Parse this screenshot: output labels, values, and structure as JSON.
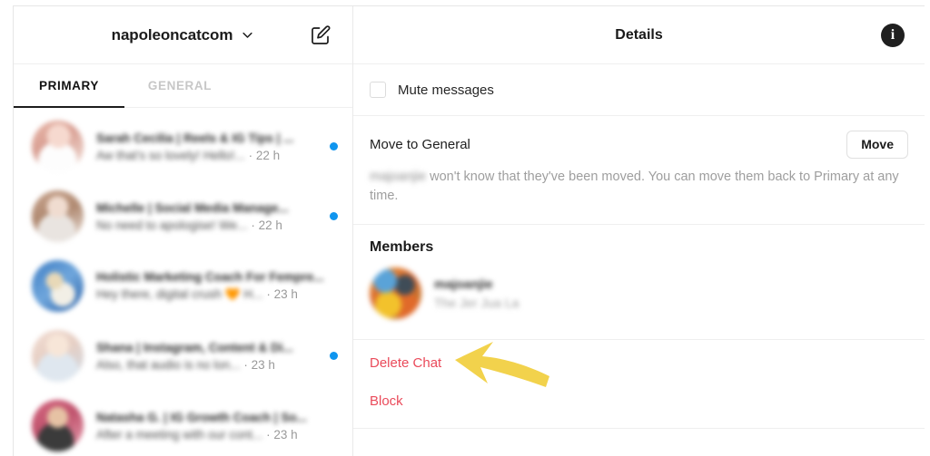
{
  "window": {
    "left_panel": {
      "header": {
        "account_name": "napoleoncatcom",
        "chevron_icon": "chevron-down-icon",
        "compose_icon": "compose-edit-icon"
      },
      "tabs": [
        {
          "label": "PRIMARY",
          "active": true
        },
        {
          "label": "GENERAL",
          "active": false
        }
      ],
      "conversations": [
        {
          "name": "Sarah Cecilia | Reels & IG Tips | ...",
          "preview": "Aw that's so lovely! Hello!...",
          "time": "· 22 h",
          "unread": true
        },
        {
          "name": "Michelle | Social Media Manage...",
          "preview": "No need to apologise! We...",
          "time": "· 22 h",
          "unread": true
        },
        {
          "name": "Holistic Marketing Coach For Fempre...",
          "preview": "Hey there, digital crush 🧡 H...",
          "time": "· 23 h",
          "unread": false
        },
        {
          "name": "Shana | Instagram, Content & Di...",
          "preview": "Also, that audio is no lon...",
          "time": "· 23 h",
          "unread": true
        },
        {
          "name": "Natasha G. | IG Growth Coach | So...",
          "preview": "After a meeting with our cont...",
          "time": "· 23 h",
          "unread": false
        }
      ]
    },
    "right_panel": {
      "header": {
        "title": "Details",
        "info_icon": "info-circle-icon",
        "info_glyph": "i"
      },
      "mute": {
        "label": "Mute messages",
        "checked": false,
        "checkbox_icon": "checkbox-unchecked-icon"
      },
      "move": {
        "title": "Move to General",
        "button_label": "Move",
        "redacted_username": "majoanjie",
        "description": " won't know that they've been moved. You can move them back to Primary at any time."
      },
      "members": {
        "title": "Members",
        "list": [
          {
            "name": "majoanjie",
            "subtitle": "The Jer Jua La",
            "avatar_icon": "member-avatar"
          }
        ]
      },
      "actions": [
        {
          "label": "Delete Chat",
          "name": "delete-chat-link"
        },
        {
          "label": "Block",
          "name": "block-link"
        }
      ],
      "annotation": {
        "arrow_icon": "arrow-left-annotation",
        "color": "#F2D24C",
        "points_to": "Delete Chat"
      }
    }
  },
  "colors": {
    "accent_blue": "#0F95EF",
    "danger_red": "#EA4A5A",
    "annotation_yellow": "#F2D24C",
    "text_primary": "#1B1B1B",
    "text_muted": "#9E9E9E",
    "border": "#EFEFEF"
  }
}
